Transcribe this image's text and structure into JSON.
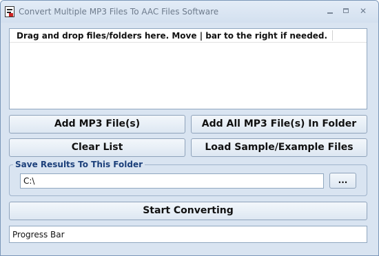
{
  "window": {
    "title": "Convert Multiple MP3 Files To AAC Files Software",
    "controls": {
      "minimize": "",
      "maximize": "",
      "close": "✕"
    }
  },
  "file_list": {
    "header": "Drag and drop files/folders here. Move | bar to the right if needed.",
    "items": []
  },
  "buttons": {
    "add_files": "Add MP3 File(s)",
    "add_folder": "Add All MP3 File(s) In Folder",
    "clear_list": "Clear List",
    "load_samples": "Load Sample/Example Files",
    "browse": "...",
    "start": "Start Converting"
  },
  "save_folder": {
    "label": "Save Results To This Folder",
    "path": "C:\\"
  },
  "progress": {
    "label": "Progress Bar",
    "fraction": 0
  },
  "colors": {
    "window_bg": "#d9e4f1",
    "group_label": "#1b3f7a",
    "border": "#8fa6bf"
  }
}
